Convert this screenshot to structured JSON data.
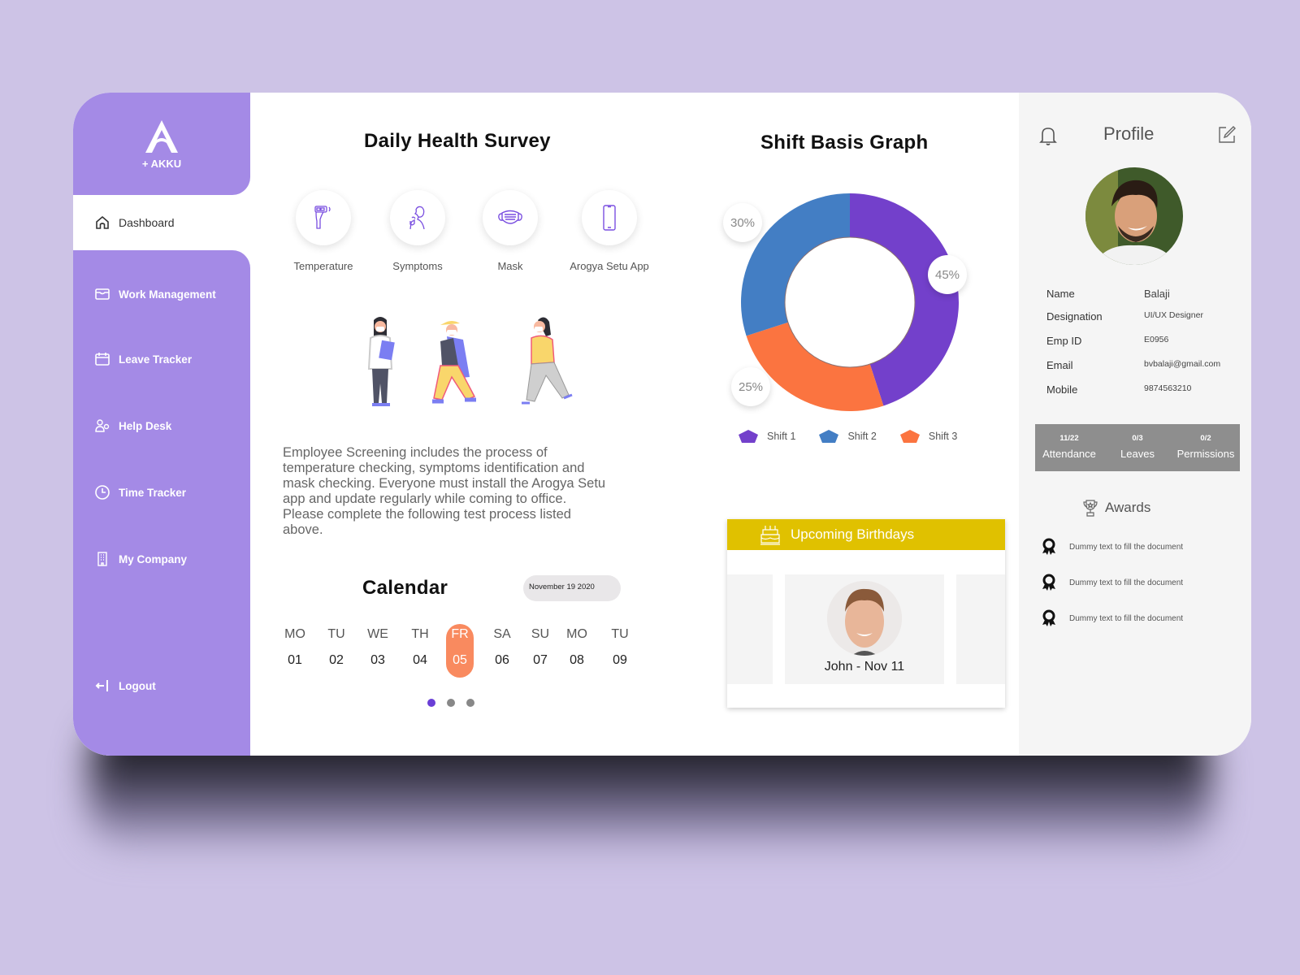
{
  "brand": {
    "name": "+ AKKU",
    "accent": "#a48ae6"
  },
  "sidebar": {
    "active": {
      "label": "Dashboard",
      "icon": "home-icon"
    },
    "items": [
      {
        "label": "Work Management",
        "icon": "inbox-tray-icon"
      },
      {
        "label": "Leave Tracker",
        "icon": "calendar-icon"
      },
      {
        "label": "Help Desk",
        "icon": "user-help-icon"
      },
      {
        "label": "Time Tracker",
        "icon": "clock-icon"
      },
      {
        "label": "My Company",
        "icon": "building-icon"
      }
    ],
    "logout": {
      "label": "Logout",
      "icon": "logout-arrow-icon"
    }
  },
  "survey": {
    "title": "Daily Health Survey",
    "items": [
      {
        "label": "Temperature",
        "icon": "thermometer-gun-icon"
      },
      {
        "label": "Symptoms",
        "icon": "coughing-person-icon"
      },
      {
        "label": "Mask",
        "icon": "face-mask-icon"
      },
      {
        "label": "Arogya Setu App",
        "icon": "smartphone-icon"
      }
    ],
    "illustration": "masked-people-walking-illustration",
    "description": "Employee Screening includes the process of temperature checking, symptoms identification and mask checking.  Everyone must install the Arogya Setu app and update regularly while coming to office.  Please complete the following test process listed above."
  },
  "calendar": {
    "title": "Calendar",
    "selected_date": "November 19 2020",
    "days": [
      {
        "name": "MO",
        "date": "01"
      },
      {
        "name": "TU",
        "date": "02"
      },
      {
        "name": "WE",
        "date": "03"
      },
      {
        "name": "TH",
        "date": "04"
      },
      {
        "name": "FR",
        "date": "05",
        "active": true
      },
      {
        "name": "SA",
        "date": "06"
      },
      {
        "name": "SU",
        "date": "07"
      },
      {
        "name": "MO",
        "date": "08"
      },
      {
        "name": "TU",
        "date": "09"
      }
    ],
    "pagination": {
      "pages": 3,
      "current": 1
    },
    "active_color": "#f98a5f"
  },
  "shift_graph": {
    "title": "Shift Basis Graph",
    "labels": {
      "shift1": "45%",
      "shift2": "30%",
      "shift3": "25%"
    }
  },
  "chart_data": {
    "type": "pie",
    "donut": true,
    "title": "Shift Basis Graph",
    "categories": [
      "Shift 1",
      "Shift 2",
      "Shift 3"
    ],
    "values": [
      45,
      30,
      25
    ],
    "colors": [
      "#7340cb",
      "#437ec4",
      "#fb7440"
    ],
    "legend": "bottom"
  },
  "birthdays": {
    "title": "Upcoming Birthdays",
    "icon": "birthday-cake-icon",
    "header_color": "#e0c100",
    "cards": [
      {
        "name": "John - Nov 11"
      }
    ]
  },
  "profile": {
    "title": "Profile",
    "fields": [
      {
        "label": "Name",
        "value": "Balaji"
      },
      {
        "label": "Designation",
        "value": "UI/UX Designer"
      },
      {
        "label": "Emp ID",
        "value": "E0956"
      },
      {
        "label": "Email",
        "value": "bvbalaji@gmail.com"
      },
      {
        "label": "Mobile",
        "value": "9874563210"
      }
    ],
    "stats": [
      {
        "value": "11/22",
        "label": "Attendance"
      },
      {
        "value": "0/3",
        "label": "Leaves"
      },
      {
        "value": "0/2",
        "label": "Permissions"
      }
    ],
    "awards": {
      "title": "Awards",
      "items": [
        "Dummy text to fill the document",
        "Dummy text to fill the document",
        "Dummy text to fill the document"
      ]
    }
  }
}
